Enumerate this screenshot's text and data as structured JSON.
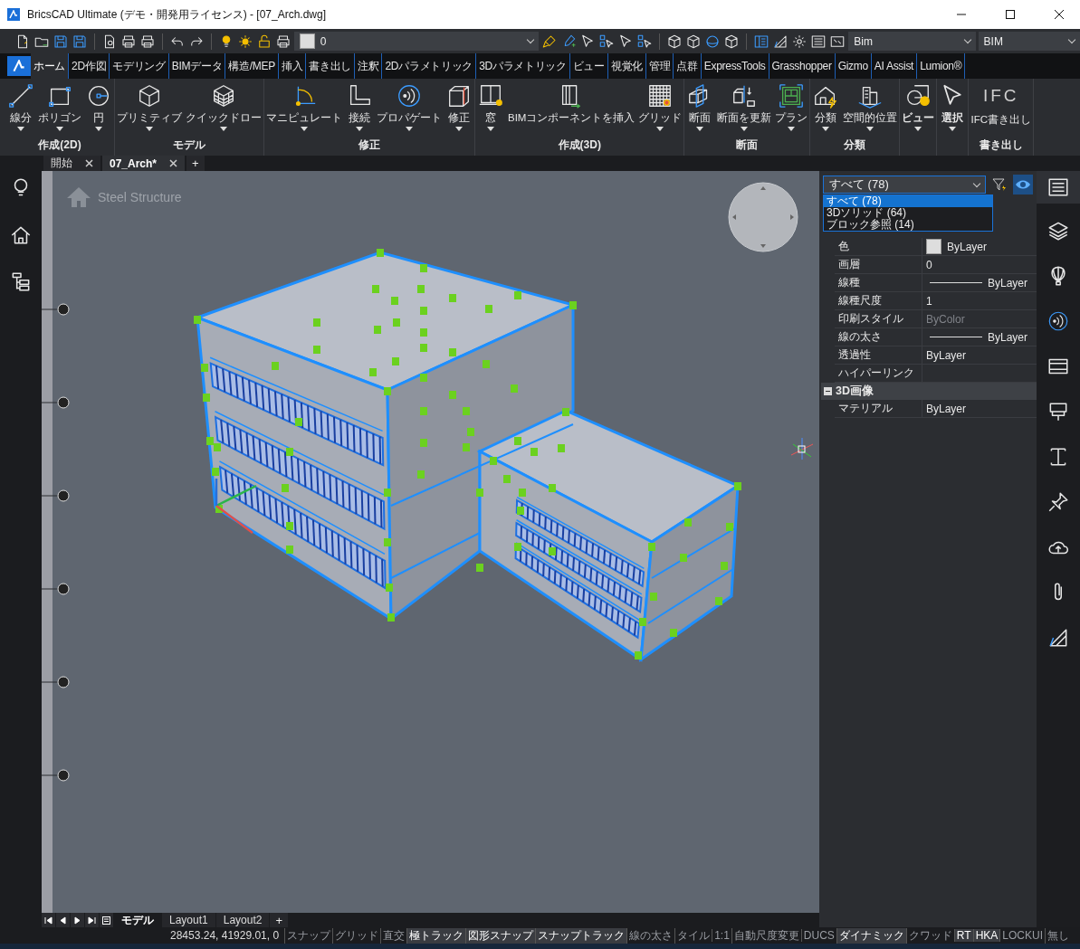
{
  "window": {
    "title": "BricsCAD Ultimate (デモ・開発用ライセンス) - [07_Arch.dwg]"
  },
  "toolbar": {
    "layer_value": "0",
    "workspace_value": "Bim",
    "profile_value": "BIM"
  },
  "ribbon": {
    "tabs": [
      {
        "label": "ホーム",
        "selected": true
      },
      {
        "label": "2D作図",
        "selected": false
      },
      {
        "label": "モデリング",
        "selected": false
      },
      {
        "label": "BIMデータ",
        "selected": false
      },
      {
        "label": "構造/MEP",
        "selected": false
      },
      {
        "label": "挿入",
        "selected": false
      },
      {
        "label": "書き出し",
        "selected": false
      },
      {
        "label": "注釈",
        "selected": false
      },
      {
        "label": "2Dパラメトリック",
        "selected": false
      },
      {
        "label": "3Dパラメトリック",
        "selected": false
      },
      {
        "label": "ビュー",
        "selected": false
      },
      {
        "label": "視覚化",
        "selected": false
      },
      {
        "label": "管理",
        "selected": false
      },
      {
        "label": "点群",
        "selected": false
      },
      {
        "label": "ExpressTools",
        "selected": false
      },
      {
        "label": "Grasshopper",
        "selected": false
      },
      {
        "label": "Gizmo",
        "selected": false
      },
      {
        "label": "AI Assist",
        "selected": false
      },
      {
        "label": "Lumion®",
        "selected": false
      }
    ],
    "panels": [
      {
        "title": "作成(2D)",
        "tools": [
          {
            "label": "線分",
            "dropdown": true
          },
          {
            "label": "ポリゴン",
            "dropdown": true
          },
          {
            "label": "円",
            "dropdown": true
          }
        ]
      },
      {
        "title": "モデル",
        "tools": [
          {
            "label": "プリミティブ",
            "dropdown": true
          },
          {
            "label": "クイックドロー",
            "dropdown": true
          }
        ]
      },
      {
        "title": "修正",
        "tools": [
          {
            "label": "マニピュレート",
            "dropdown": true
          },
          {
            "label": "接続",
            "dropdown": true
          },
          {
            "label": "プロパゲート",
            "dropdown": true
          },
          {
            "label": "修正",
            "dropdown": true
          }
        ]
      },
      {
        "title": "作成(3D)",
        "tools": [
          {
            "label": "窓",
            "dropdown": true
          },
          {
            "label": "BIMコンポーネントを挿入",
            "dropdown": false
          },
          {
            "label": "グリッド",
            "dropdown": true
          }
        ]
      },
      {
        "title": "断面",
        "tools": [
          {
            "label": "断面",
            "dropdown": true
          },
          {
            "label": "断面を更新",
            "dropdown": true
          },
          {
            "label": "プラン",
            "dropdown": true
          }
        ]
      },
      {
        "title": "分類",
        "tools": [
          {
            "label": "分類",
            "dropdown": true
          },
          {
            "label": "空間的位置",
            "dropdown": true
          }
        ]
      },
      {
        "tools": [
          {
            "label": "ビュー",
            "dropdown": true
          }
        ]
      },
      {
        "tools": [
          {
            "label": "選択",
            "dropdown": true
          }
        ]
      },
      {
        "title": "書き出し",
        "tools": [
          {
            "label": "IFC書き出し",
            "dropdown": false,
            "icon_text": "IFC"
          }
        ]
      }
    ]
  },
  "document_tabs": {
    "tabs": [
      {
        "label": "開始",
        "selected": false
      },
      {
        "label": "07_Arch*",
        "selected": true
      }
    ],
    "add": "+"
  },
  "viewport": {
    "view_label": "Steel Structure"
  },
  "layout_tabs": {
    "tabs": [
      {
        "label": "モデル",
        "selected": true
      },
      {
        "label": "Layout1",
        "selected": false
      },
      {
        "label": "Layout2",
        "selected": false
      }
    ],
    "add": "+"
  },
  "properties": {
    "filter": {
      "value": "すべて (78)",
      "expanded": true,
      "options": [
        {
          "label": "すべて (78)",
          "selected": true
        },
        {
          "label": "3Dソリッド (64)",
          "selected": false
        },
        {
          "label": "ブロック参照 (14)",
          "selected": false
        }
      ]
    },
    "rows": [
      {
        "kind": "swatch",
        "label": "色",
        "value": "ByLayer",
        "disabled": false
      },
      {
        "kind": "plain",
        "label": "画層",
        "value": "0",
        "disabled": false
      },
      {
        "kind": "line",
        "label": "線種",
        "value": "ByLayer",
        "disabled": false
      },
      {
        "kind": "plain",
        "label": "線種尺度",
        "value": "1",
        "disabled": false
      },
      {
        "kind": "plain",
        "label": "印刷スタイル",
        "value": "ByColor",
        "disabled": true
      },
      {
        "kind": "line",
        "label": "線の太さ",
        "value": "ByLayer",
        "disabled": false
      },
      {
        "kind": "plain",
        "label": "透過性",
        "value": "ByLayer",
        "disabled": false
      },
      {
        "kind": "plain",
        "label": "ハイパーリンク"
      },
      {
        "kind": "section",
        "label": "3D画像",
        "expanded": true
      },
      {
        "kind": "plain",
        "label": "マテリアル",
        "value": "ByLayer",
        "disabled": false
      }
    ]
  },
  "status_bar": {
    "coordinates": "28453.24, 41929.01, 0",
    "toggles": [
      {
        "label": "スナップ",
        "on": false
      },
      {
        "label": "グリッド",
        "on": false
      },
      {
        "label": "直交",
        "on": false
      },
      {
        "label": "極トラック",
        "on": true
      },
      {
        "label": "図形スナップ",
        "on": true
      },
      {
        "label": "スナップトラック",
        "on": true
      },
      {
        "label": "線の太さ",
        "on": false
      },
      {
        "label": "タイル",
        "on": false
      },
      {
        "label": "1:1",
        "on": false
      },
      {
        "label": "自動尺度変更",
        "on": false
      },
      {
        "label": "DUCS",
        "on": false
      },
      {
        "label": "ダイナミック",
        "on": true
      },
      {
        "label": "クワッド",
        "on": false
      },
      {
        "label": "RT",
        "on": true
      },
      {
        "label": "HKA",
        "on": true
      },
      {
        "label": "LOCKUI",
        "on": false
      },
      {
        "label": "無し",
        "on": false
      }
    ]
  }
}
